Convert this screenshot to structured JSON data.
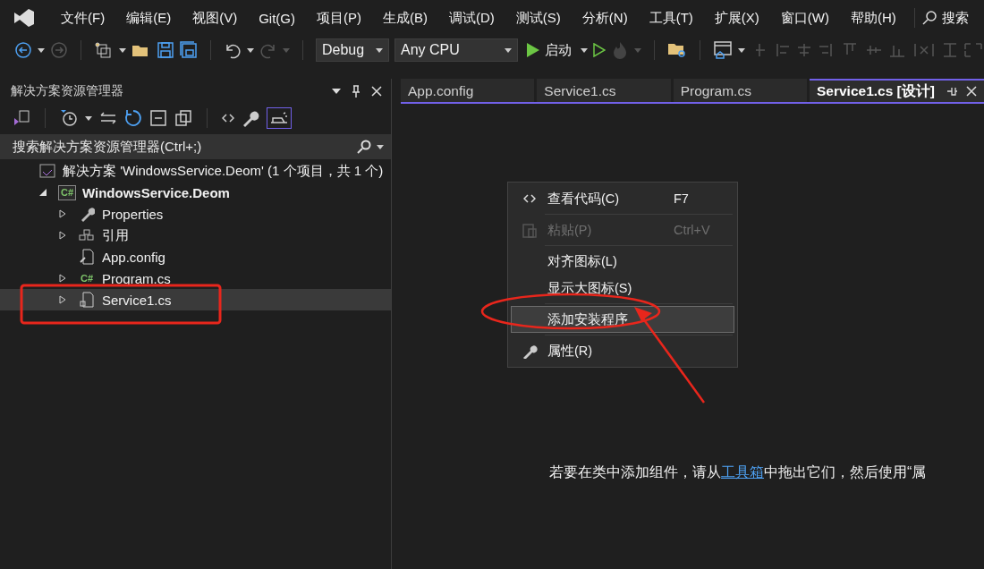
{
  "menu_bar": {
    "items": [
      "文件(F)",
      "编辑(E)",
      "视图(V)",
      "Git(G)",
      "项目(P)",
      "生成(B)",
      "调试(D)",
      "测试(S)",
      "分析(N)",
      "工具(T)",
      "扩展(X)",
      "窗口(W)",
      "帮助(H)"
    ],
    "search": "搜索"
  },
  "toolbar": {
    "configuration": "Debug",
    "platform": "Any CPU",
    "start": "启动"
  },
  "solution_explorer": {
    "title": "解决方案资源管理器",
    "search": {
      "placeholder": "搜索解决方案资源管理器(Ctrl+;)"
    },
    "tree": [
      {
        "kind": "solution",
        "label": "解决方案 'WindowsService.Deom' (1 个项目，共 1 个)",
        "selected": false,
        "children": [
          {
            "kind": "project",
            "icon_text": "C#",
            "label": "WindowsService.Deom",
            "expanded": true,
            "selected": false,
            "children": [
              {
                "kind": "properties",
                "label": "Properties",
                "expanded": false,
                "selected": false
              },
              {
                "kind": "references",
                "label": "引用",
                "expanded": false,
                "selected": false
              },
              {
                "kind": "config",
                "label": "App.config",
                "selected": false
              },
              {
                "kind": "csharp",
                "icon_text": "C#",
                "label": "Program.cs",
                "expanded": false,
                "selected": false
              },
              {
                "kind": "component",
                "label": "Service1.cs",
                "expanded": false,
                "selected": true
              }
            ]
          }
        ]
      }
    ]
  },
  "editor_tabs": [
    {
      "label": "App.config",
      "selected": false
    },
    {
      "label": "Service1.cs",
      "selected": false
    },
    {
      "label": "Program.cs",
      "selected": false
    },
    {
      "label": "Service1.cs [设计]",
      "selected": true
    }
  ],
  "context_menu": [
    {
      "kind": "code",
      "label": "查看代码(C)",
      "shortcut": "F7",
      "disabled": false,
      "selected": false
    },
    {
      "kind": "separator"
    },
    {
      "kind": "paste",
      "label": "粘贴(P)",
      "shortcut": "Ctrl+V",
      "disabled": true,
      "selected": false
    },
    {
      "kind": "separator"
    },
    {
      "kind": "item",
      "label": "对齐图标(L)",
      "disabled": false,
      "selected": false
    },
    {
      "kind": "item",
      "label": "显示大图标(S)",
      "disabled": false,
      "selected": false
    },
    {
      "kind": "separator"
    },
    {
      "kind": "item",
      "label": "添加安装程序",
      "disabled": false,
      "selected": true
    },
    {
      "kind": "separator"
    },
    {
      "kind": "wrench",
      "label": "属性(R)",
      "disabled": false,
      "selected": false
    }
  ],
  "designer_hint": {
    "before": "若要在类中添加组件，请从",
    "link": "工具箱",
    "after": "中拖出它们，然后使用“属"
  }
}
